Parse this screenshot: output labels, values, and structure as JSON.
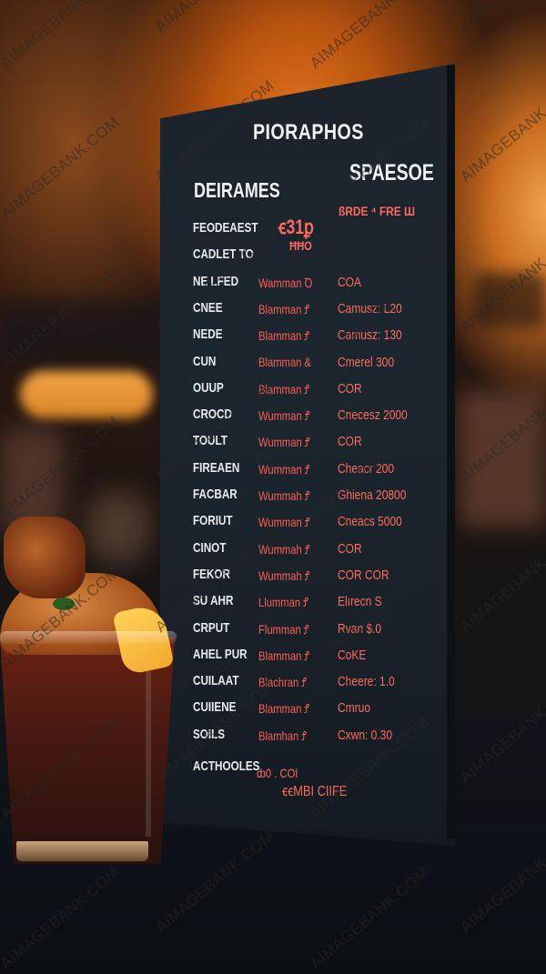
{
  "scene": {
    "subject": "menu board beside dessert glass",
    "colors": {
      "background_warm": "#e2761c",
      "board": "#1c262e",
      "heading_text": "#f2f2f2",
      "item_name_text": "#e9ecef",
      "accent_red": "#ff6a5e"
    }
  },
  "menu": {
    "title": "PIORAPHOS",
    "left_heading": "DEIRAMES",
    "right_heading": "SPAESOE",
    "special_line": "ßRDE ⁴ FRE Ш",
    "promo_price": "ꞓ31ꝑ",
    "promo_small": "ĦĦO",
    "rows": [
      {
        "name": "FEODEAEST",
        "desc": "",
        "price": ""
      },
      {
        "name": "CADLET TO",
        "desc": "",
        "price": ""
      },
      {
        "name": "NE LFED",
        "desc": "Wamman Ꝺ",
        "price": "COA"
      },
      {
        "name": "CNEE",
        "desc": "Blamman Ꝭ",
        "price": "Camusz: L20"
      },
      {
        "name": "NEDE",
        "desc": "Blamman Ꝭ",
        "price": "Camusz: 130"
      },
      {
        "name": "CUN",
        "desc": "Blamman &",
        "price": "Cmerel 300"
      },
      {
        "name": "OUUP",
        "desc": "Blamman Ꝭ",
        "price": "COR"
      },
      {
        "name": "CROCD",
        "desc": "Wumman Ꝭ",
        "price": "Cnecesz 2000"
      },
      {
        "name": "TOULT",
        "desc": "Wumman Ꝭ",
        "price": "COR"
      },
      {
        "name": "FIREAEN",
        "desc": "Wumman Ꝭ",
        "price": "Cheacr 200"
      },
      {
        "name": "FACBAR",
        "desc": "Wummah Ꝭ",
        "price": "Ghiena 20800"
      },
      {
        "name": "FORIUT",
        "desc": "Wumman Ꝭ",
        "price": "Cneacs 5000"
      },
      {
        "name": "CINOT",
        "desc": "Wummah Ꝭ",
        "price": "COR"
      },
      {
        "name": "FEKOR",
        "desc": "Wummah Ꝭ",
        "price": "COR COR"
      },
      {
        "name": "SU AHR",
        "desc": "Llumman Ꝭ",
        "price": "Elırecn S"
      },
      {
        "name": "CRPUT",
        "desc": "Flumman Ꝭ",
        "price": "Rvan $.0"
      },
      {
        "name": "AHEL PUR",
        "desc": "Blamman Ꝭ",
        "price": "CoKE"
      },
      {
        "name": "CUILAAT",
        "desc": "Blachran Ꝭ",
        "price": "Cheere: 1.0"
      },
      {
        "name": "CUIIENE",
        "desc": "Blamman Ꝭ",
        "price": "Cmruo"
      },
      {
        "name": "SOILS",
        "desc": "Blamhan Ꝭ",
        "price": "Cxwn: 0.30"
      }
    ],
    "footer_label": "ACTHOOLES",
    "footer_line_a": "ȸ0 . COI",
    "footer_line_b": "ꞓꞓMBI CIIFE"
  },
  "watermark": {
    "text": "AIMAGEBANK.COM"
  }
}
